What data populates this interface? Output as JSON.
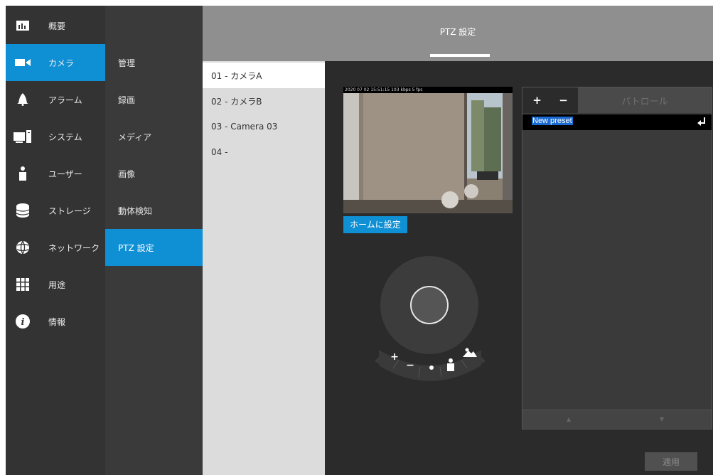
{
  "nav_primary": {
    "items": [
      {
        "label": "概要",
        "icon": "chart-bar-icon"
      },
      {
        "label": "カメラ",
        "icon": "camera-icon"
      },
      {
        "label": "アラーム",
        "icon": "bell-icon"
      },
      {
        "label": "システム",
        "icon": "computer-icon"
      },
      {
        "label": "ユーザー",
        "icon": "user-icon"
      },
      {
        "label": "ストレージ",
        "icon": "database-icon"
      },
      {
        "label": "ネットワーク",
        "icon": "globe-icon"
      },
      {
        "label": "用途",
        "icon": "apps-grid-icon"
      },
      {
        "label": "情報",
        "icon": "info-icon"
      }
    ],
    "active_index": 1
  },
  "nav_secondary": {
    "items": [
      {
        "label": "管理"
      },
      {
        "label": "録画"
      },
      {
        "label": "メディア"
      },
      {
        "label": "画像"
      },
      {
        "label": "動体検知"
      },
      {
        "label": "PTZ 設定"
      }
    ],
    "active_index": 5
  },
  "header": {
    "title": "PTZ 設定"
  },
  "camera_list": {
    "items": [
      {
        "label": "01 - カメラA"
      },
      {
        "label": "02 - カメラB"
      },
      {
        "label": "03 - Camera 03"
      },
      {
        "label": "04 -"
      }
    ],
    "active_index": 0
  },
  "preview": {
    "osd_text": "2020 07 02 15:51:15  103 kbps  5 fps"
  },
  "ptz": {
    "home_button": "ホームに設定",
    "zoom_in": "+",
    "zoom_out": "−"
  },
  "presets": {
    "add_label": "+",
    "remove_label": "−",
    "patrol_label": "パトロール",
    "items": [
      {
        "name": "New preset"
      }
    ]
  },
  "footer": {
    "apply_label": "適用"
  },
  "colors": {
    "accent": "#0f8fd4"
  }
}
